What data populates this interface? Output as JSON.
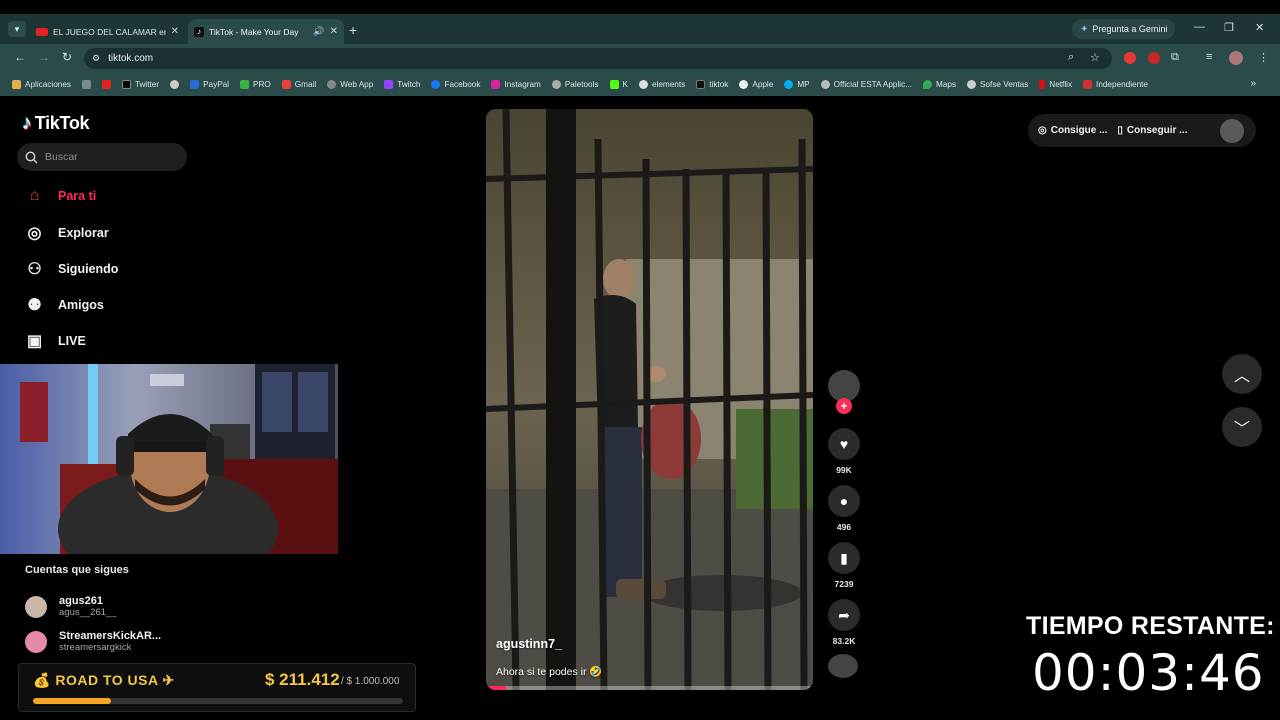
{
  "browser": {
    "tabs": [
      {
        "title": "EL JUEGO DEL CALAMAR en la V",
        "active": false
      },
      {
        "title": "TikTok - Make Your Day",
        "active": true
      }
    ],
    "gemini_label": "Pregunta a Gemini",
    "url": "tiktok.com",
    "bookmarks": [
      "Aplicaciones",
      "",
      "Twitter",
      "",
      "PayPal",
      "PRO",
      "Gmail",
      "Web App",
      "Twitch",
      "Facebook",
      "Instagram",
      "Paletools",
      "K",
      "elements",
      "tiktok",
      "Apple",
      "MP",
      "Official ESTA Applic...",
      "Maps",
      "Sofse Ventas",
      "Netflix",
      "Independiente"
    ]
  },
  "tiktok": {
    "logo_text": "TikTok",
    "search_placeholder": "Buscar",
    "nav": [
      {
        "label": "Para ti",
        "icon": "home-icon",
        "active": true
      },
      {
        "label": "Explorar",
        "icon": "compass-icon",
        "active": false
      },
      {
        "label": "Siguiendo",
        "icon": "user-plus-icon",
        "active": false
      },
      {
        "label": "Amigos",
        "icon": "friends-icon",
        "active": false
      },
      {
        "label": "LIVE",
        "icon": "tv-icon",
        "active": false
      }
    ],
    "following_title": "Cuentas que sigues",
    "following": [
      {
        "name": "agus261",
        "handle": "agus__261__"
      },
      {
        "name": "StreamersKickAR...",
        "handle": "streamersargkick"
      }
    ],
    "top_buttons": [
      {
        "label": "Consigue ...",
        "icon": "coin-icon"
      },
      {
        "label": "Conseguir ...",
        "icon": "phone-icon"
      }
    ],
    "video": {
      "author": "agustinn7_",
      "caption": "Ahora si te podes ir 🤣",
      "progress": 0.06
    },
    "actions": {
      "likes": "99K",
      "comments": "496",
      "saves": "7239",
      "shares": "83.2K"
    }
  },
  "overlay": {
    "road_title": "ROAD TO USA",
    "road_amount": "$ 211.412",
    "road_goal": "/ $ 1.000.000",
    "road_progress": 0.211,
    "timer_label": "TIEMPO RESTANTE:",
    "timer_value": "00:03:46"
  },
  "colors": {
    "tiktok_accent": "#fe2c55",
    "overlay_gold": "#f3c646",
    "chrome_bg": "#2b4a4a"
  }
}
